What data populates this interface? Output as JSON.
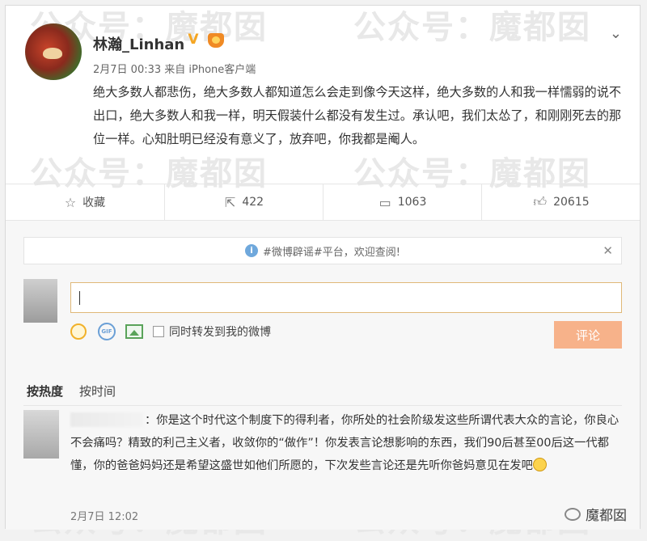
{
  "post": {
    "username": "林瀚_Linhan",
    "verified_badge": "V",
    "meta": "2月7日 00:33 来自 iPhone客户端",
    "text": "绝大多数人都悲伤，绝大多数人都知道怎么会走到像今天这样，绝大多数的人和我一样懦弱的说不出口，绝大多数人和我一样，明天假装什么都没有发生过。承认吧，我们太怂了，和刚刚死去的那位一样。心知肚明已经没有意义了，放弃吧，你我都是阉人。"
  },
  "actions": {
    "favorite_label": "收藏",
    "repost_count": "422",
    "comment_count": "1063",
    "like_count": "20615"
  },
  "notice": {
    "text": "#微博辟谣#平台，欢迎查阅!"
  },
  "composer": {
    "forward_label": "同时转发到我的微博",
    "submit_label": "评论",
    "gif_label": "GIF"
  },
  "sort": {
    "hot_label": "按热度",
    "time_label": "按时间"
  },
  "comment": {
    "text": "：你是这个时代这个制度下的得利者，你所处的社会阶级发这些所谓代表大众的言论，你良心不会痛吗？精致的利己主义者，收敛你的“做作”！你发表言论想影响的东西，我们90后甚至00后这一代都懂，你的爸爸妈妈还是希望这盛世如他们所愿的，下次发些言论还是先听你爸妈意见在发吧",
    "time": "2月7日 12:02"
  },
  "watermark": {
    "text": "公众号：魔都囡",
    "logo_text": "魔都囡"
  },
  "colors": {
    "submit_bg": "#f7b28a",
    "input_border": "#e0b878",
    "verified": "#f5a623"
  }
}
